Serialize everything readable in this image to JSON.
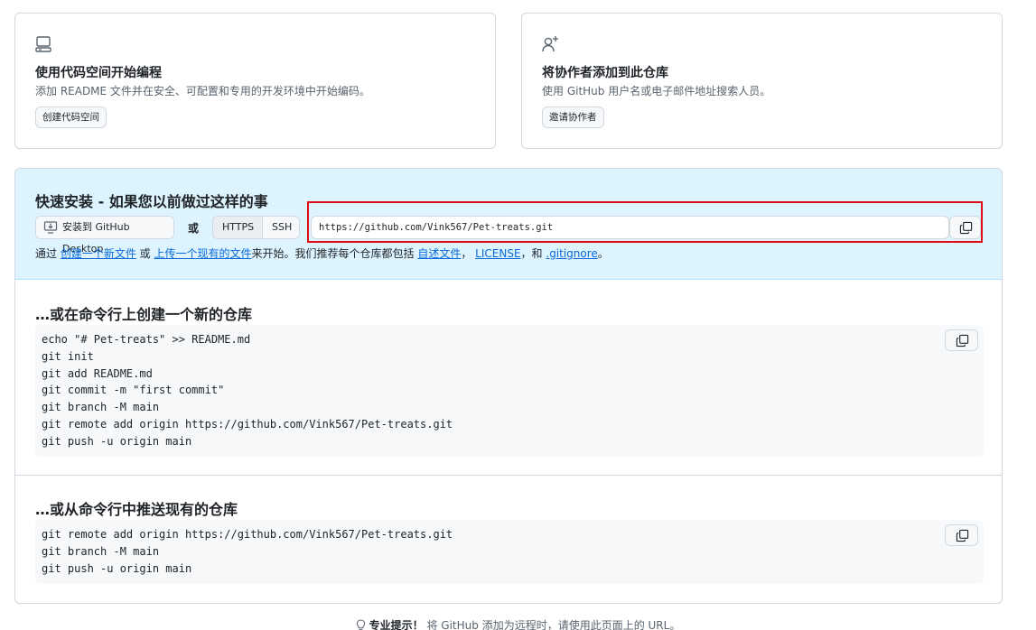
{
  "cards": [
    {
      "icon": "codespaces-icon",
      "title": "使用代码空间开始编程",
      "description": "添加 README 文件并在安全、可配置和专用的开发环境中开始编码。",
      "button": "创建代码空间"
    },
    {
      "icon": "person-add-icon",
      "title": "将协作者添加到此仓库",
      "description": "使用 GitHub 用户名或电子邮件地址搜索人员。",
      "button": "邀请协作者"
    }
  ],
  "quick_setup": {
    "title": "快速安装 - 如果您以前做过这样的事",
    "desktop_button": "安装到 GitHub Desktop",
    "or_label": "或",
    "protocols": [
      "HTTPS",
      "SSH"
    ],
    "selected_protocol": "HTTPS",
    "clone_url": "https://github.com/Vink567/Pet-treats.git",
    "hint": {
      "prefix": "通过 ",
      "link_new_file": "创建一个新文件",
      "mid1": " 或 ",
      "link_upload": "上传一个现有的文件",
      "mid2": "来开始。我们推荐每个仓库都包括 ",
      "link_readme": "自述文件",
      "sep1": "， ",
      "link_license": "LICENSE",
      "sep2": "，和 ",
      "link_gitignore": ".gitignore",
      "suffix": "。"
    }
  },
  "create_section": {
    "title": "…或在命令行上创建一个新的仓库",
    "code": [
      "echo \"# Pet-treats\" >> README.md",
      "git init",
      "git add README.md",
      "git commit -m \"first commit\"",
      "git branch -M main",
      "git remote add origin https://github.com/Vink567/Pet-treats.git",
      "git push -u origin main"
    ]
  },
  "push_section": {
    "title": "…或从命令行中推送现有的仓库",
    "code": [
      "git remote add origin https://github.com/Vink567/Pet-treats.git",
      "git branch -M main",
      "git push -u origin main"
    ]
  },
  "protip": {
    "label": "专业提示！",
    "text": " 将 GitHub 添加为远程时，请使用此页面上的 URL。"
  },
  "colors": {
    "link": "#0969da",
    "quick_bg": "#ddf4ff",
    "highlight_box": "#e00d18",
    "border": "#d0d7de"
  }
}
